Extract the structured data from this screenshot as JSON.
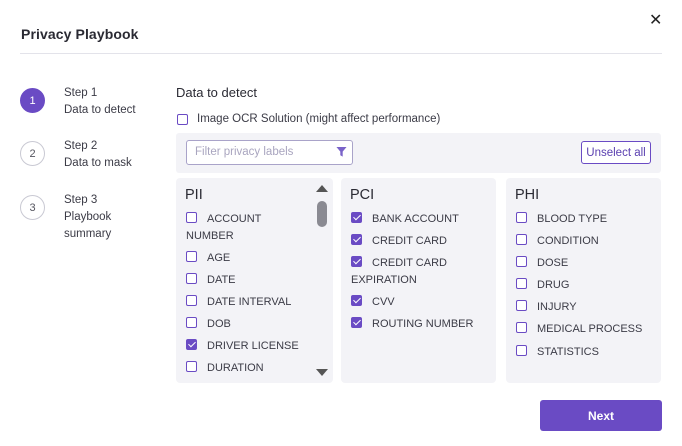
{
  "dialog": {
    "title": "Privacy Playbook",
    "close_glyph": "✕",
    "close_icon": "close-icon"
  },
  "steps": [
    {
      "number": "1",
      "label": "Step 1",
      "desc": "Data to detect",
      "active": true
    },
    {
      "number": "2",
      "label": "Step 2",
      "desc": "Data to mask",
      "active": false
    },
    {
      "number": "3",
      "label": "Step 3",
      "desc": "Playbook summary",
      "active": false
    }
  ],
  "main": {
    "section_title": "Data to detect",
    "ocr_label": "Image OCR Solution (might affect performance)",
    "ocr_checked": false,
    "filter_placeholder": "Filter privacy labels",
    "filter_icon": "filter-icon",
    "unselect_all_label": "Unselect all"
  },
  "categories": {
    "pii": {
      "title": "PII",
      "items": [
        {
          "label": "ACCOUNT NUMBER",
          "checked": false
        },
        {
          "label": "AGE",
          "checked": false
        },
        {
          "label": "DATE",
          "checked": false
        },
        {
          "label": "DATE INTERVAL",
          "checked": false
        },
        {
          "label": "DOB",
          "checked": false
        },
        {
          "label": "DRIVER LICENSE",
          "checked": true
        },
        {
          "label": "DURATION",
          "checked": false
        }
      ]
    },
    "pci": {
      "title": "PCI",
      "items": [
        {
          "label": "BANK ACCOUNT",
          "checked": true
        },
        {
          "label": "CREDIT CARD",
          "checked": true
        },
        {
          "label": "CREDIT CARD EXPIRATION",
          "checked": true
        },
        {
          "label": "CVV",
          "checked": true
        },
        {
          "label": "ROUTING NUMBER",
          "checked": true
        }
      ]
    },
    "phi": {
      "title": "PHI",
      "items": [
        {
          "label": "BLOOD TYPE",
          "checked": false
        },
        {
          "label": "CONDITION",
          "checked": false
        },
        {
          "label": "DOSE",
          "checked": false
        },
        {
          "label": "DRUG",
          "checked": false
        },
        {
          "label": "INJURY",
          "checked": false
        },
        {
          "label": "MEDICAL PROCESS",
          "checked": false
        },
        {
          "label": "STATISTICS",
          "checked": false
        }
      ]
    }
  },
  "footer": {
    "next_label": "Next"
  },
  "colors": {
    "accent": "#6a4bc4",
    "panel_bg": "#f3f3f7"
  }
}
